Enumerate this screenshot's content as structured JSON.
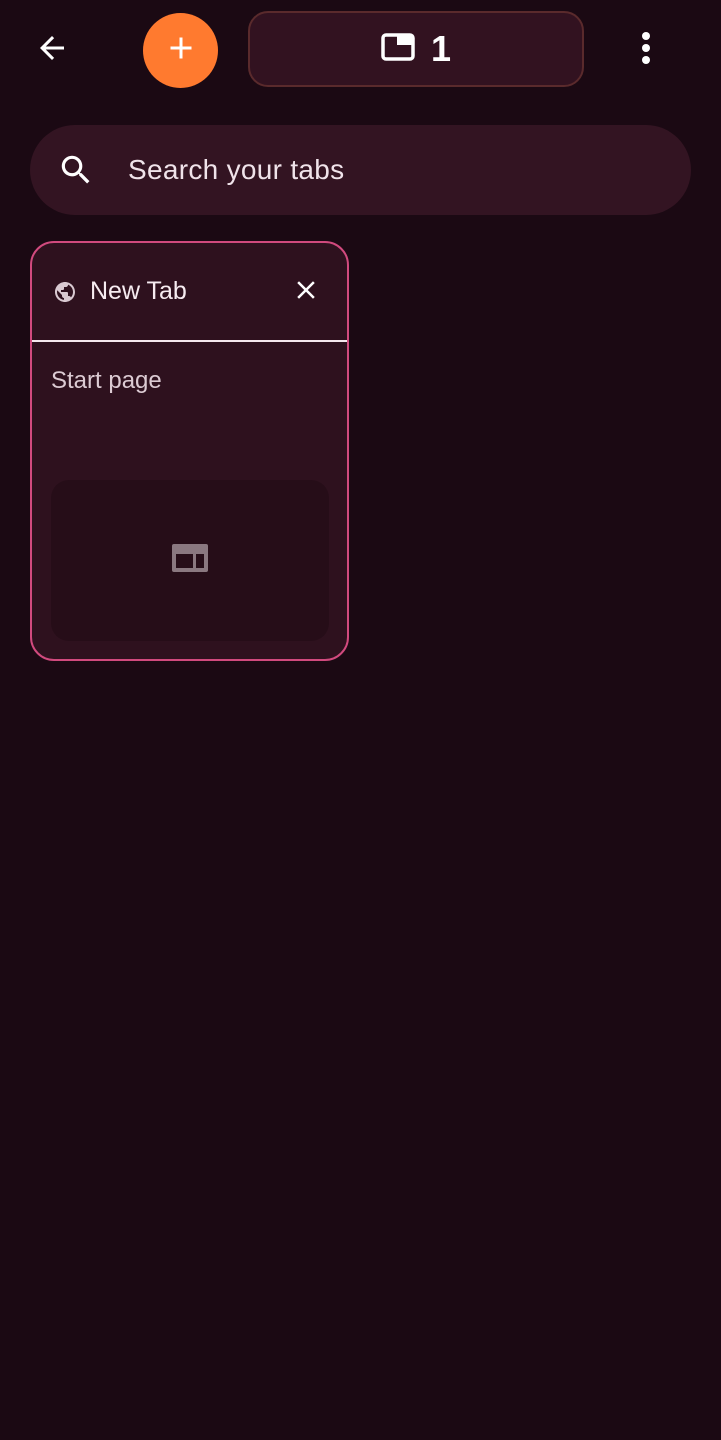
{
  "topbar": {
    "back_icon": "arrow-left-icon",
    "add_icon": "plus-icon",
    "add_color": "#ff7a2f",
    "tab_counter_icon": "tab-window-icon",
    "tab_count": "1",
    "menu_icon": "more-vertical-icon"
  },
  "search": {
    "icon": "search-icon",
    "placeholder": "Search your tabs"
  },
  "tabs": [
    {
      "favicon": "globe-icon",
      "title": "New Tab",
      "close_icon": "close-icon",
      "subtitle": "Start page",
      "preview_icon": "web-page-icon"
    }
  ],
  "colors": {
    "background": "#1b0913",
    "surface": "#331422",
    "accent_border": "#d14a7e",
    "add_button": "#ff7a2f"
  }
}
